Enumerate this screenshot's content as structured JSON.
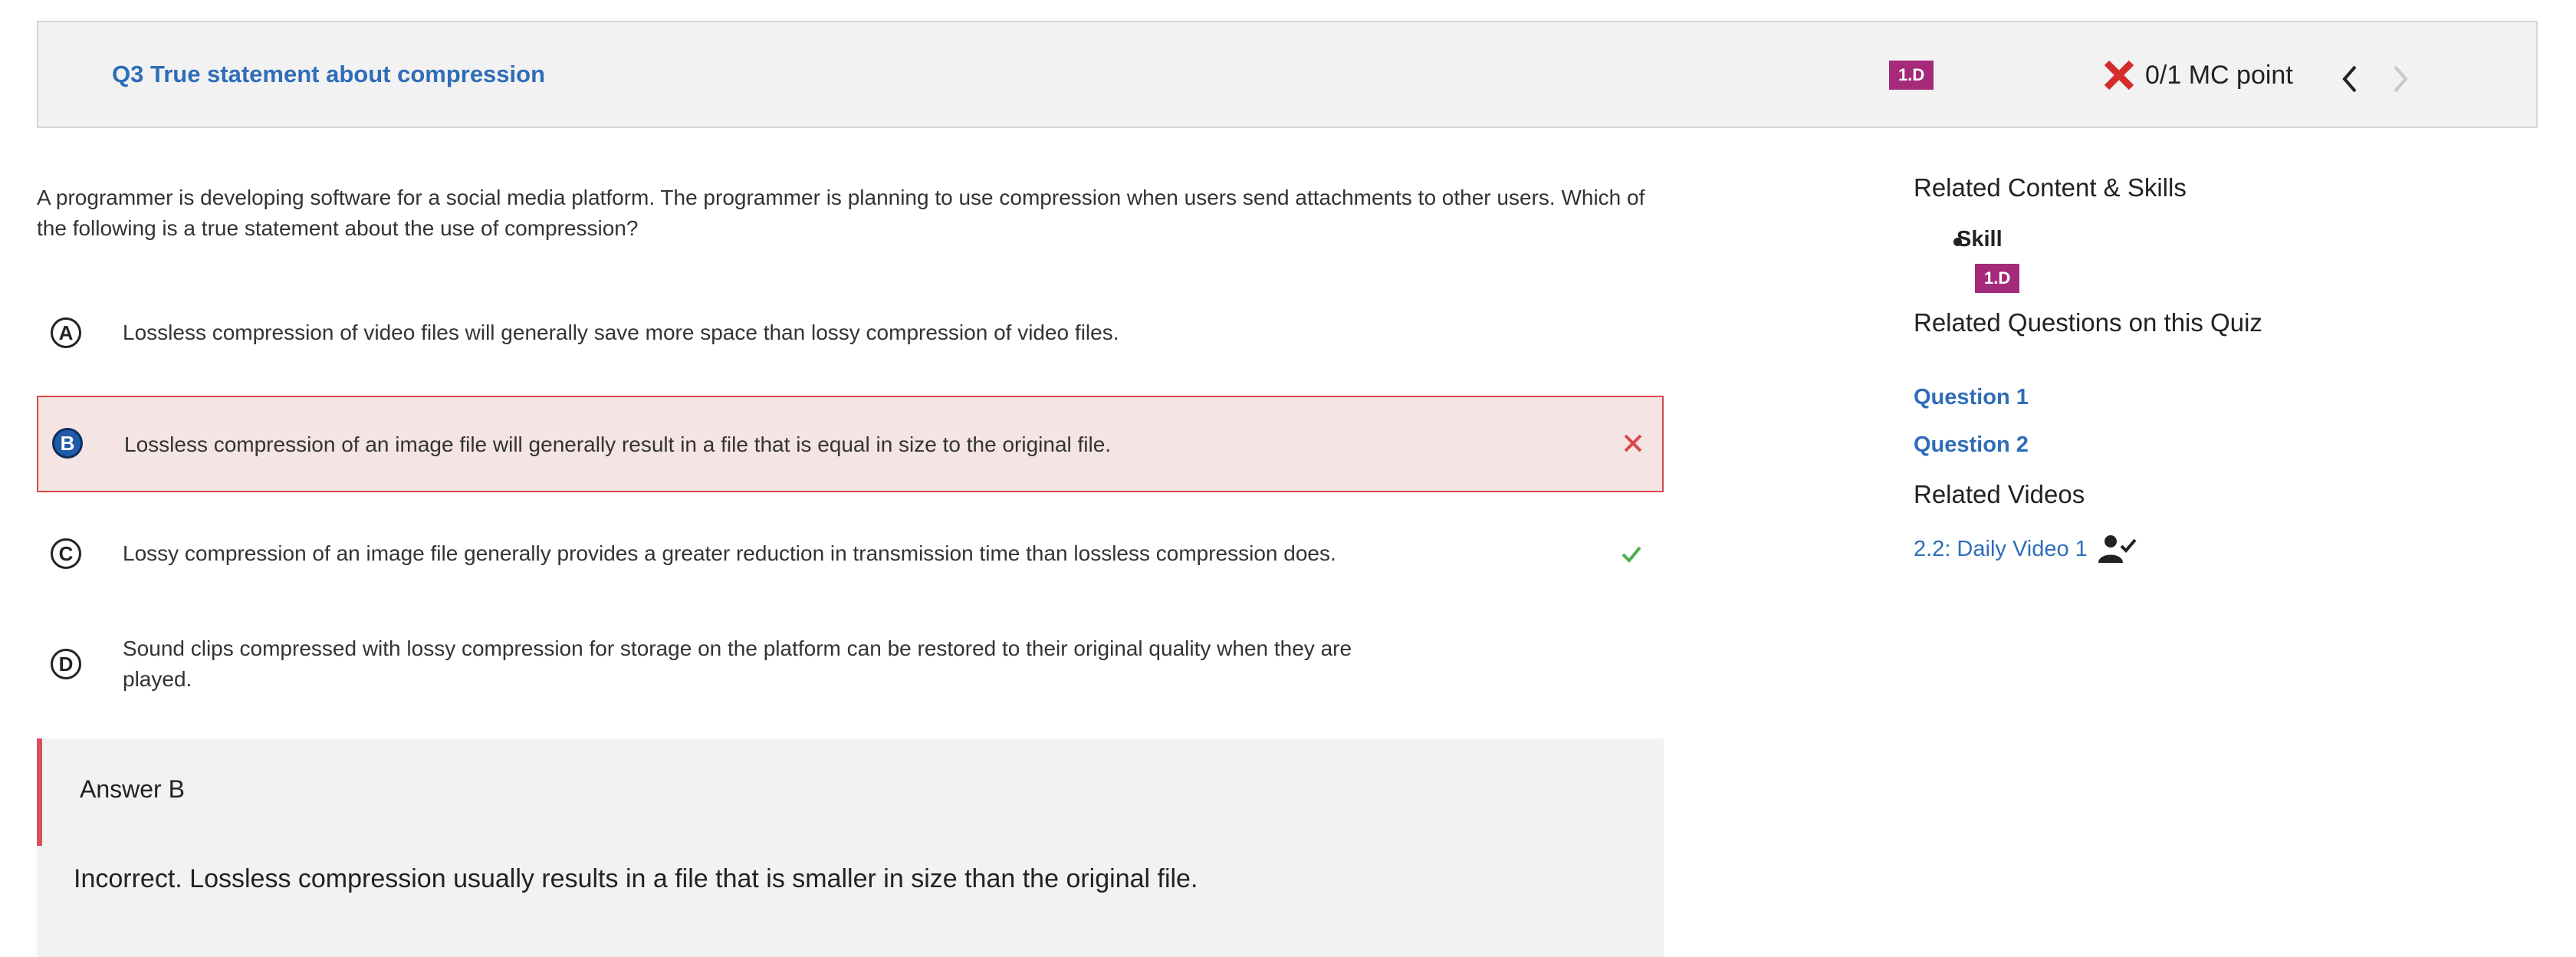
{
  "header": {
    "question_title": "Q3 True statement about compression",
    "skill_badge": "1.D",
    "score_text": "0/1 MC point",
    "prev_icon": "chevron-left-icon",
    "next_icon": "chevron-right-icon",
    "status_icon": "x-icon"
  },
  "question": {
    "text": "A programmer is developing software for a social media platform. The programmer is planning to use compression when users send attachments to other users. Which of the following is a true statement about the use of compression?"
  },
  "options": [
    {
      "letter": "A",
      "text": "Lossless compression of video files will generally save more space than lossy compression of video files."
    },
    {
      "letter": "B",
      "text": "Lossless compression of an image file will generally result in a file that is equal in size to the original file.",
      "selected": true,
      "mark": "incorrect"
    },
    {
      "letter": "C",
      "text": "Lossy compression of an image file generally provides a greater reduction in transmission time than lossless compression does.",
      "mark": "correct"
    },
    {
      "letter": "D",
      "text_line1": "Sound clips compressed with lossy compression for storage on the platform can be restored to their original quality when they are",
      "text_line2": "played."
    }
  ],
  "answer": {
    "label": "Answer B",
    "explanation": "Incorrect. Lossless compression usually results in a file that is smaller in size than the original file."
  },
  "sidebar": {
    "related_content_heading": "Related Content & Skills",
    "skill_label": "Skill",
    "skill_badge": "1.D",
    "related_questions_heading": "Related Questions on this Quiz",
    "questions": [
      "Question 1",
      "Question 2"
    ],
    "related_videos_heading": "Related Videos",
    "video_label": "2.2: Daily Video 1",
    "video_icon": "person-check-icon"
  },
  "colors": {
    "link": "#2f6db8",
    "badge": "#a52a7a",
    "incorrect": "#d94848",
    "correct": "#4caf50",
    "selected_option": "#1f5ba8"
  }
}
